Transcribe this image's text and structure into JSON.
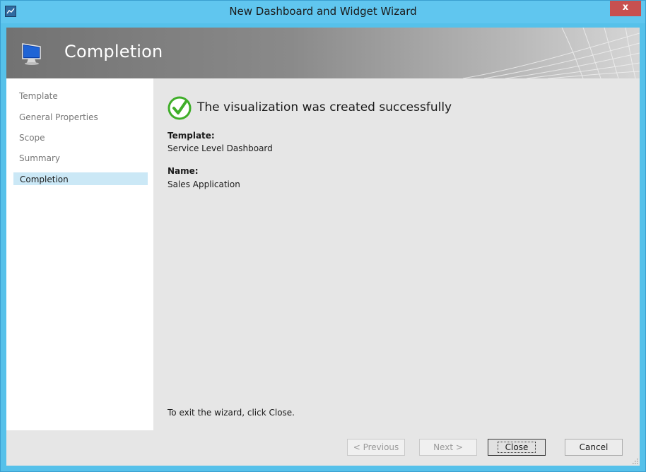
{
  "window": {
    "title": "New Dashboard and Widget Wizard",
    "close_label": "x"
  },
  "banner": {
    "title": "Completion"
  },
  "nav": {
    "items": [
      {
        "label": "Template",
        "active": false
      },
      {
        "label": "General Properties",
        "active": false
      },
      {
        "label": "Scope",
        "active": false
      },
      {
        "label": "Summary",
        "active": false
      },
      {
        "label": "Completion",
        "active": true
      }
    ]
  },
  "content": {
    "success_message": "The visualization was created successfully",
    "fields": [
      {
        "label": "Template:",
        "value": "Service Level Dashboard"
      },
      {
        "label": "Name:",
        "value": "Sales Application"
      }
    ],
    "exit_instruction": "To exit the wizard, click Close."
  },
  "buttons": {
    "previous": "< Previous",
    "next": "Next >",
    "close": "Close",
    "cancel": "Cancel"
  },
  "colors": {
    "titlebar": "#60c6ef",
    "success_green": "#3fae29",
    "active_nav": "#cbe8f6"
  },
  "icons": {
    "system_menu": "window-icon",
    "banner": "monitor-icon",
    "success": "checkmark-circle-icon",
    "resize": "resize-grip-icon"
  }
}
